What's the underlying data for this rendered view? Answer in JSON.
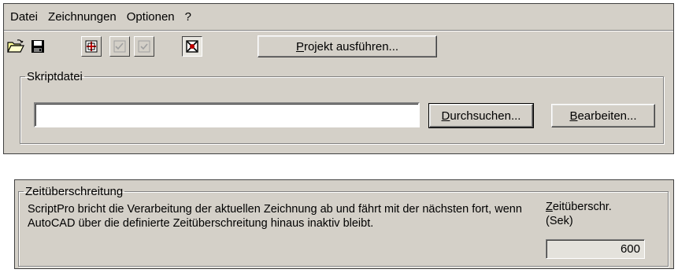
{
  "menu": {
    "items": [
      {
        "label": "Datei"
      },
      {
        "label": "Zeichnungen"
      },
      {
        "label": "Optionen"
      },
      {
        "label": "?"
      }
    ]
  },
  "toolbar": {
    "buttons": [
      {
        "icon": "open-folder-icon",
        "state": "enabled"
      },
      {
        "icon": "save-disk-icon",
        "state": "enabled"
      },
      {
        "icon": "add-drawing-icon",
        "state": "enabled"
      },
      {
        "icon": "check-drawings-icon",
        "state": "disabled"
      },
      {
        "icon": "checkbox-icon",
        "state": "disabled"
      },
      {
        "icon": "settings-drawing-icon",
        "state": "pressed"
      }
    ],
    "run_project_label": "Projekt ausführen...",
    "run_project_mnemonic": "P",
    "run_project_rest": "rojekt ausführen..."
  },
  "script_file": {
    "group_label": "Skriptdatei",
    "path_value": "",
    "browse_mnemonic": "D",
    "browse_rest": "urchsuchen...",
    "edit_mnemonic": "B",
    "edit_rest": "earbeiten..."
  },
  "timeout": {
    "group_label": "Zeitüberschreitung",
    "description": "ScriptPro bricht die Verarbeitung der aktuellen Zeichnung ab und fährt mit der nächsten fort, wenn AutoCAD über die definierte Zeitüberschreitung hinaus inaktiv bleibt.",
    "field_label_mnemonic": "Z",
    "field_label_rest": "eitüberschr.",
    "field_label_unit": "(Sek)",
    "value": "600"
  },
  "colors": {
    "face": "#d4d0c8",
    "shadow": "#808080",
    "highlight": "#ffffff"
  }
}
